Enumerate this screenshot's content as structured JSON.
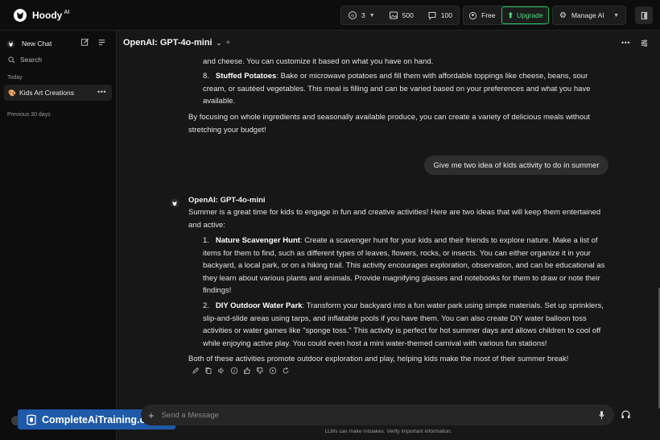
{
  "app": {
    "brand": "Hoody",
    "brand_sup": "AI"
  },
  "topbar": {
    "stats": [
      {
        "icon": "ai-model-icon",
        "value": "3"
      },
      {
        "icon": "image-icon",
        "value": "500"
      },
      {
        "icon": "message-icon",
        "value": "100"
      }
    ],
    "plan": "Free",
    "upgrade": "Upgrade",
    "manage": "Manage AI"
  },
  "sidebar": {
    "new_chat": "New Chat",
    "search": "Search",
    "section_today": "Today",
    "chat_item": "Kids Art Creations",
    "chat_item_emoji": "🎨",
    "section_prev": "Previous 30 days"
  },
  "watermark": "CompleteAiTraining.com",
  "header": {
    "model": "OpenAI: GPT-4o-mini"
  },
  "messages": {
    "prev_line": "and cheese. You can customize it based on what you have on hand.",
    "prev_item8_num": "8.",
    "prev_item8_title": "Stuffed Potatoes",
    "prev_item8_l1": ": Bake or microwave potatoes and fill them with affordable toppings like cheese, beans, sour",
    "prev_item8_l2": "cream, or sautéed vegetables. This meal is filling and can be varied based on your preferences and what you have",
    "prev_item8_l3": "available.",
    "prev_closing_l1": "By focusing on whole ingredients and seasonally available produce, you can create a variety of delicious meals without",
    "prev_closing_l2": "stretching your budget!",
    "user_msg": "Give me two idea of kids activity to do in summer",
    "bot_name": "OpenAI: GPT-4o-mini",
    "intro_l1": "Summer is a great time for kids to engage in fun and creative activities! Here are two ideas that will keep them entertained",
    "intro_l2": "and active:",
    "item1_num": "1.",
    "item1_title": "Nature Scavenger Hunt",
    "item1_l1": ": Create a scavenger hunt for your kids and their friends to explore nature. Make a list of",
    "item1_l2": "items for them to find, such as different types of leaves, flowers, rocks, or insects. You can either organize it in your",
    "item1_l3": "backyard, a local park, or on a hiking trail. This activity encourages exploration, observation, and can be educational as",
    "item1_l4": "they learn about various plants and animals. Provide magnifying glasses and notebooks for them to draw or note their",
    "item1_l5": "findings!",
    "item2_num": "2.",
    "item2_title": "DIY Outdoor Water Park",
    "item2_l1": ": Transform your backyard into a fun water park using simple materials. Set up sprinklers,",
    "item2_l2": "slip-and-slide areas using tarps, and inflatable pools if you have them. You can also create DIY water balloon toss",
    "item2_l3": "activities or water games like \"sponge toss.\" This activity is perfect for hot summer days and allows children to cool off",
    "item2_l4": "while enjoying active play. You could even host a mini water-themed carnival with various fun stations!",
    "closing": "Both of these activities promote outdoor exploration and play, helping kids make the most of their summer break!"
  },
  "input": {
    "placeholder": "Send a Message"
  },
  "disclaimer": "LLMs can make mistakes. Verify important information.",
  "colors": {
    "accent_green": "#22c55e",
    "background": "#171717",
    "sidebar": "#0d0d0d",
    "watermark": "#1e5aa8"
  }
}
